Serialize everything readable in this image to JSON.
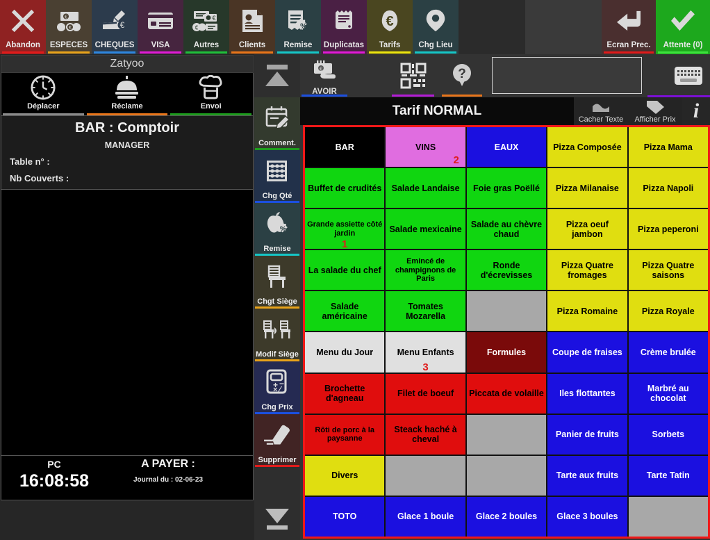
{
  "topbar": {
    "buttons": [
      {
        "label": "Abandon",
        "name": "abandon",
        "bg": "#8f2222",
        "ul": "#e01b1b",
        "icon": "close-x-icon"
      },
      {
        "label": "ESPECES",
        "name": "especes",
        "bg": "#4a4032",
        "ul": "#e8a31a",
        "icon": "cash-icon"
      },
      {
        "label": "CHEQUES",
        "name": "cheques",
        "bg": "#2c3b4c",
        "ul": "#2e86de",
        "icon": "cheque-icon"
      },
      {
        "label": "VISA",
        "name": "visa",
        "bg": "#46253f",
        "ul": "#e01bd6",
        "icon": "credit-card-icon"
      },
      {
        "label": "Autres",
        "name": "autres",
        "bg": "#27382a",
        "ul": "#1fbf3a",
        "icon": "other-payments-icon"
      },
      {
        "label": "Clients",
        "name": "clients",
        "bg": "#4a3525",
        "ul": "#e8751a",
        "icon": "customer-file-icon"
      },
      {
        "label": "Remise",
        "name": "remise",
        "bg": "#2b4044",
        "ul": "#16c6c6",
        "icon": "receipt-percent-icon"
      },
      {
        "label": "Duplicatas",
        "name": "duplicatas",
        "bg": "#4a2044",
        "ul": "#e01bd6",
        "icon": "duplicate-receipt-icon"
      },
      {
        "label": "Tarifs",
        "name": "tarifs",
        "bg": "#4a4620",
        "ul": "#ece40f",
        "icon": "price-tag-euro-icon"
      },
      {
        "label": "Chg Lieu",
        "name": "chg-lieu",
        "bg": "#2b4044",
        "ul": "#16c6c6",
        "icon": "map-pin-icon"
      }
    ],
    "right_buttons": [
      {
        "label": "Ecran Prec.",
        "name": "ecran-precedent",
        "bg": "#4a2f2f",
        "ul": "#e01b1b",
        "icon": "back-arrow-icon"
      },
      {
        "label": "Attente (0)",
        "name": "attente",
        "bg": "#1da81d",
        "ul": "#3ee03e",
        "icon": "check-icon"
      }
    ]
  },
  "left": {
    "brand": "Zatyoo",
    "quick_buttons": [
      {
        "label": "Déplacer",
        "name": "deplacer",
        "ul": "#8a8a8a",
        "icon": "clock-icon"
      },
      {
        "label": "Réclame",
        "name": "reclame",
        "ul": "#e8751a",
        "icon": "bell-dome-icon"
      },
      {
        "label": "Envoi",
        "name": "envoi",
        "ul": "#1d9c1d",
        "icon": "chef-hat-icon"
      }
    ],
    "order": {
      "location": "BAR : Comptoir",
      "role": "MANAGER",
      "table_label": "Table n° :",
      "covers_label": "Nb Couverts :"
    },
    "footer": {
      "pc_label": "PC",
      "clock": "16:08:58",
      "a_payer_label": "A PAYER :",
      "journal": "Journal du : 02-06-23"
    }
  },
  "vstrip": {
    "scroll_up": "scroll-up-icon",
    "scroll_down": "scroll-down-icon",
    "buttons": [
      {
        "label": "Comment.",
        "name": "commentaire",
        "bg": "#333a2e",
        "ul": "#1d9c1d",
        "icon": "note-pencil-icon"
      },
      {
        "label": "Chg Qté",
        "name": "chg-qte",
        "bg": "#22314a",
        "ul": "#1b4fe0",
        "icon": "abacus-icon"
      },
      {
        "label": "Remise",
        "name": "remise-ligne",
        "bg": "#2b4044",
        "ul": "#16c6c6",
        "icon": "apple-percent-icon"
      },
      {
        "label": "Chgt Siège",
        "name": "chgt-siege",
        "bg": "#3d3a2a",
        "ul": "#e8a31a",
        "icon": "chair-icon"
      },
      {
        "label": "Modif Siège",
        "name": "modif-siege",
        "bg": "#3d3a2a",
        "ul": "#e8a31a",
        "icon": "swap-chairs-icon"
      },
      {
        "label": "Chg Prix",
        "name": "chg-prix",
        "bg": "#252a52",
        "ul": "#1b4fe0",
        "icon": "calculator-icon"
      },
      {
        "label": "Supprimer",
        "name": "supprimer",
        "bg": "#412424",
        "ul": "#e01b1b",
        "icon": "eraser-icon"
      }
    ]
  },
  "right": {
    "tools": [
      {
        "label": "AVOIR",
        "name": "avoir",
        "ul": "#1b4fe0",
        "icon": "credit-note-icon"
      },
      {
        "label": "",
        "name": "qrcode",
        "ul": "#b41bd6",
        "icon": "qr-code-icon"
      },
      {
        "label": "",
        "name": "help",
        "ul": "#e8751a",
        "icon": "help-question-icon"
      }
    ],
    "search_value": "",
    "keyboard_icon": "keyboard-icon",
    "tarif_title": "Tarif NORMAL",
    "tarif_actions": [
      {
        "label": "Cacher Texte",
        "name": "cacher-texte",
        "icon": "hide-text-icon"
      },
      {
        "label": "Afficher Prix",
        "name": "afficher-prix",
        "icon": "show-price-tag-icon"
      }
    ],
    "info_label": "i"
  },
  "colors": {
    "black": "#000000",
    "pink": "#e06de0",
    "blue": "#1b10e0",
    "yellow": "#e0de10",
    "green": "#10d610",
    "grey": "#a8a8a8",
    "lightgrey": "#e0e0e0",
    "darkred": "#7a0a0a",
    "red": "#e00d0d",
    "white_text": "#ffffff",
    "black_text": "#000000",
    "qty_red": "#e01b1b"
  },
  "grid": {
    "columns": 5,
    "rows": 10,
    "cells": [
      {
        "label": "BAR",
        "bg": "black",
        "fg": "white_text",
        "name": "bar"
      },
      {
        "label": "VINS",
        "bg": "pink",
        "fg": "black_text",
        "qty": "2",
        "name": "vins"
      },
      {
        "label": "EAUX",
        "bg": "blue",
        "fg": "white_text",
        "name": "eaux"
      },
      {
        "label": "Pizza Composée",
        "bg": "yellow",
        "fg": "black_text",
        "name": "pizza-composee"
      },
      {
        "label": "Pizza Mama",
        "bg": "yellow",
        "fg": "black_text",
        "name": "pizza-mama"
      },
      {
        "label": "Buffet de crudités",
        "bg": "green",
        "fg": "black_text",
        "name": "buffet-de-crudites"
      },
      {
        "label": "Salade Landaise",
        "bg": "green",
        "fg": "black_text",
        "name": "salade-landaise"
      },
      {
        "label": "Foie gras Poëllé",
        "bg": "green",
        "fg": "black_text",
        "name": "foie-gras-poelle"
      },
      {
        "label": "Pizza Milanaise",
        "bg": "yellow",
        "fg": "black_text",
        "name": "pizza-milanaise"
      },
      {
        "label": "Pizza Napoli",
        "bg": "yellow",
        "fg": "black_text",
        "name": "pizza-napoli"
      },
      {
        "label": "Grande assiette côté jardin",
        "bg": "green",
        "fg": "black_text",
        "small": true,
        "qty": "1",
        "qty_center": true,
        "name": "grande-assiette-cote-jardin"
      },
      {
        "label": "Salade mexicaine",
        "bg": "green",
        "fg": "black_text",
        "name": "salade-mexicaine"
      },
      {
        "label": "Salade au chèvre chaud",
        "bg": "green",
        "fg": "black_text",
        "name": "salade-au-chevre-chaud"
      },
      {
        "label": "Pizza oeuf jambon",
        "bg": "yellow",
        "fg": "black_text",
        "name": "pizza-oeuf-jambon"
      },
      {
        "label": "Pizza peperoni",
        "bg": "yellow",
        "fg": "black_text",
        "name": "pizza-peperoni"
      },
      {
        "label": "La salade du chef",
        "bg": "green",
        "fg": "black_text",
        "name": "la-salade-du-chef"
      },
      {
        "label": "Emincé de champignons de Paris",
        "bg": "green",
        "fg": "black_text",
        "small": true,
        "name": "emince-de-champignons-de-paris"
      },
      {
        "label": "Ronde d'écrevisses",
        "bg": "green",
        "fg": "black_text",
        "name": "ronde-decrevisses"
      },
      {
        "label": "Pizza Quatre fromages",
        "bg": "yellow",
        "fg": "black_text",
        "name": "pizza-quatre-fromages"
      },
      {
        "label": "Pizza Quatre saisons",
        "bg": "yellow",
        "fg": "black_text",
        "name": "pizza-quatre-saisons"
      },
      {
        "label": "Salade américaine",
        "bg": "green",
        "fg": "black_text",
        "name": "salade-americaine"
      },
      {
        "label": "Tomates Mozarella",
        "bg": "green",
        "fg": "black_text",
        "name": "tomates-mozarella"
      },
      {
        "label": "",
        "bg": "grey",
        "fg": "black_text",
        "empty": true,
        "name": "empty"
      },
      {
        "label": "Pizza Romaine",
        "bg": "yellow",
        "fg": "black_text",
        "name": "pizza-romaine"
      },
      {
        "label": "Pizza Royale",
        "bg": "yellow",
        "fg": "black_text",
        "name": "pizza-royale"
      },
      {
        "label": "Menu du Jour",
        "bg": "lightgrey",
        "fg": "black_text",
        "name": "menu-du-jour"
      },
      {
        "label": "Menu Enfants",
        "bg": "lightgrey",
        "fg": "black_text",
        "qty": "3",
        "qty_center": true,
        "name": "menu-enfants"
      },
      {
        "label": "Formules",
        "bg": "darkred",
        "fg": "white_text",
        "name": "formules"
      },
      {
        "label": "Coupe de fraises",
        "bg": "blue",
        "fg": "white_text",
        "name": "coupe-de-fraises"
      },
      {
        "label": "Crème brulée",
        "bg": "blue",
        "fg": "white_text",
        "name": "creme-brulee"
      },
      {
        "label": "Brochette d'agneau",
        "bg": "red",
        "fg": "black_text",
        "name": "brochette-dagneau"
      },
      {
        "label": "Filet de boeuf",
        "bg": "red",
        "fg": "black_text",
        "name": "filet-de-boeuf"
      },
      {
        "label": "Piccata de volaille",
        "bg": "red",
        "fg": "black_text",
        "name": "piccata-de-volaille"
      },
      {
        "label": "Iles flottantes",
        "bg": "blue",
        "fg": "white_text",
        "name": "iles-flottantes"
      },
      {
        "label": "Marbré au chocolat",
        "bg": "blue",
        "fg": "white_text",
        "name": "marbre-au-chocolat"
      },
      {
        "label": "Rôti de porc à la paysanne",
        "bg": "red",
        "fg": "black_text",
        "small": true,
        "name": "roti-de-porc-a-la-paysanne"
      },
      {
        "label": "Steack haché à cheval",
        "bg": "red",
        "fg": "black_text",
        "name": "steack-hache-a-cheval"
      },
      {
        "label": "",
        "bg": "grey",
        "fg": "black_text",
        "empty": true,
        "name": "empty"
      },
      {
        "label": "Panier de fruits",
        "bg": "blue",
        "fg": "white_text",
        "name": "panier-de-fruits"
      },
      {
        "label": "Sorbets",
        "bg": "blue",
        "fg": "white_text",
        "name": "sorbets"
      },
      {
        "label": "Divers",
        "bg": "yellow",
        "fg": "black_text",
        "name": "divers"
      },
      {
        "label": "",
        "bg": "grey",
        "fg": "black_text",
        "empty": true,
        "name": "empty"
      },
      {
        "label": "",
        "bg": "grey",
        "fg": "black_text",
        "empty": true,
        "name": "empty"
      },
      {
        "label": "Tarte aux fruits",
        "bg": "blue",
        "fg": "white_text",
        "name": "tarte-aux-fruits"
      },
      {
        "label": "Tarte Tatin",
        "bg": "blue",
        "fg": "white_text",
        "name": "tarte-tatin"
      },
      {
        "label": "TOTO",
        "bg": "blue",
        "fg": "white_text",
        "name": "toto"
      },
      {
        "label": "Glace 1 boule",
        "bg": "blue",
        "fg": "white_text",
        "name": "glace-1-boule"
      },
      {
        "label": "Glace 2 boules",
        "bg": "blue",
        "fg": "white_text",
        "name": "glace-2-boules"
      },
      {
        "label": "Glace 3 boules",
        "bg": "blue",
        "fg": "white_text",
        "name": "glace-3-boules"
      },
      {
        "label": "",
        "bg": "grey",
        "fg": "black_text",
        "empty": true,
        "name": "empty"
      }
    ]
  }
}
